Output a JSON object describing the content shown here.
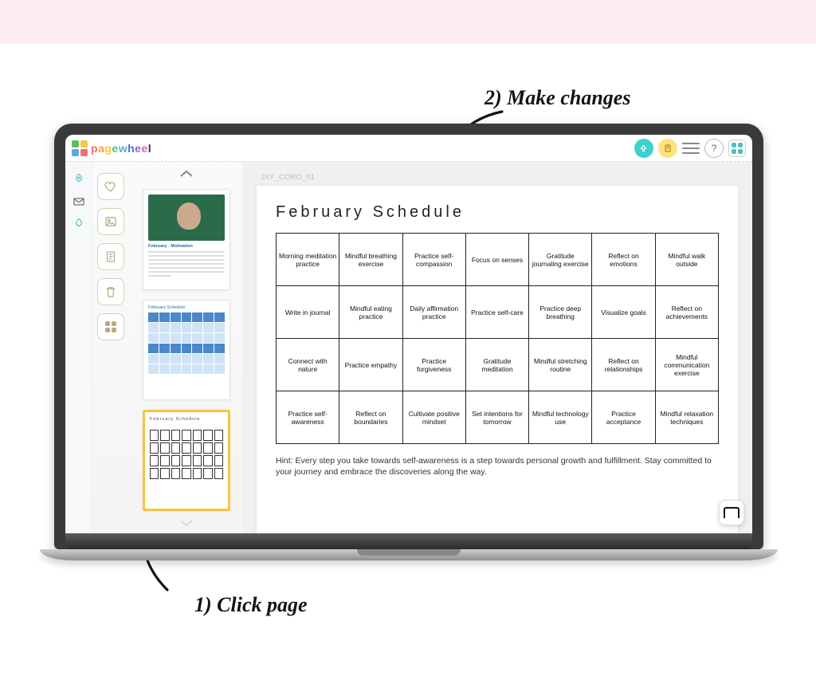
{
  "brand": "pagewheel",
  "annotations": {
    "step1": "1) Click page",
    "step2": "2) Make changes"
  },
  "topbar": {
    "help_label": "?",
    "doc_icon": "document-icon",
    "rocket_icon": "rocket-icon"
  },
  "left_rail": {
    "items": [
      "rocket",
      "mail",
      "rocket"
    ]
  },
  "tools": [
    "heart",
    "image",
    "page",
    "trash",
    "grid"
  ],
  "canvas_tab": "DIY_CORO_01",
  "thumb_titles": {
    "page1_title": "February - Motivation",
    "page2_title": "February Schedule",
    "page3_title": "February Schedule"
  },
  "page": {
    "title": "February Schedule",
    "hint": "Hint: Every step you take towards self-awareness is a step towards personal growth and fulfillment. Stay committed to your journey and embrace the discoveries along the way.",
    "grid": [
      [
        "Morning meditation practice",
        "Mindful breathing exercise",
        "Practice self-compassion",
        "Focus on senses",
        "Gratitude journaling exercise",
        "Reflect on emotions",
        "Mindful walk outside"
      ],
      [
        "Write in journal",
        "Mindful eating practice",
        "Daily affirmation practice",
        "Practice self-care",
        "Practice deep breathing",
        "Visualize goals",
        "Reflect on achievements"
      ],
      [
        "Connect with nature",
        "Practice empathy",
        "Practice forgiveness",
        "Gratitude meditation",
        "Mindful stretching routine",
        "Reflect on relationships",
        "Mindful communication exercise"
      ],
      [
        "Practice self-awareness",
        "Reflect on boundaries",
        "Cultivate positive mindset",
        "Set intentions for tomorrow",
        "Mindful technology use",
        "Practice acceptance",
        "Mindful relaxation techniques"
      ]
    ]
  }
}
